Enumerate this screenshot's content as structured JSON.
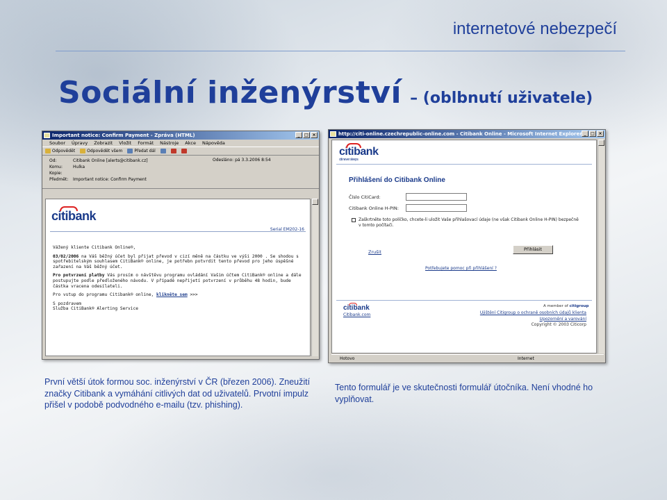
{
  "header": {
    "title": "internetové nebezpečí"
  },
  "slide": {
    "title": "Sociální inženýrství",
    "subtitle": "– (oblbnutí uživatele)"
  },
  "email_window": {
    "title": "Important notice: Confirm Payment - Zpráva (HTML)",
    "menu": [
      "Soubor",
      "Úpravy",
      "Zobrazit",
      "Vložit",
      "Formát",
      "Nástroje",
      "Akce",
      "Nápověda"
    ],
    "toolbar": [
      "Odpovědět",
      "Odpovědět všem",
      "Předat dál"
    ],
    "header_fields": {
      "from_label": "Od:",
      "from_value": "Citibank Online [alerts@citibank.cz]",
      "sent_label": "Odesláno:",
      "sent_value": "pá 3.3.2006 8:54",
      "to_label": "Komu:",
      "to_value": "Hulka",
      "cc_label": "Kopie:",
      "cc_value": "",
      "subject_label": "Předmět:",
      "subject_value": "Important notice: Confirm Payment"
    },
    "logo": "citibank",
    "serial": "Serial EM202-16",
    "body": {
      "greeting": "Vážený kliente Citibank Online®,",
      "p1_date": "03/02/2006",
      "p1": " na Váš běžný účet byl přijat převod v cizí měně na částku ve výši 2000 . Se shodou s spotřebitelským souhlasem CitiBank® online, je potřebn potvrdit tento převod pro jeho úspěšné zařazení na Váš běžný účet.",
      "p2_lead": "Pro potvrzení platby",
      "p2": " Vás prosím o návštěvu programu ovládání Vašim účtem CitiBank® online a dále postupujte podle předloženého návodu. V případě nepřijetí potvrzení v průběhu 48 hodin, bude částka vracena odesílateli.",
      "p3_text": "Pro vstup do programu Citibank® online, ",
      "p3_link": "klikněte sem",
      "p3_tail": " >>>",
      "sign1": "S pozdravem",
      "sign2": "Služba CitiBank® Alerting Service"
    }
  },
  "ie_window": {
    "title": "http://citi-online.czechrepublic-online.com - Citibank Online - Microsoft Internet Explorer",
    "logo": "citibank",
    "logo_tag": "citi never sleeps",
    "heading": "Přihlášení do Citibank Online",
    "card_label": "Číslo CitiCard:",
    "pin_label": "Citibank Online H-PIN:",
    "remember_text": "Zaškrtněte toto políčko, chcete-li uložit Vaše přihlašovací údaje (ne však Citibank Online H-PIN) bezpečně v tomto počítači.",
    "cancel_link": "Zrušit",
    "login_button": "Přihlásit",
    "help_link": "Potřebujete pomoc při přihlášení ?",
    "footer_logo": "citibank",
    "footer_link": "Citibank.com",
    "member_text": "A member of",
    "member_brand": "citigroup",
    "footer_links": [
      "Ujištění Citigroup o ochraně osobních údajů klienta",
      "Upozornění a varování"
    ],
    "copyright": "Copyright © 2003 Citicorp",
    "status_left": "Hotovo",
    "status_zone": "Internet"
  },
  "captions": {
    "left": "První větší útok formou soc. inženýrství v ČR (březen 2006). Zneužití značky Citibank a vymáhání citlivých dat od uživatelů. Prvotní impulz přišel v podobě podvodného e-mailu (tzv. phishing).",
    "right": "Tento formulář je ve skutečnosti formulář útočníka. Není vhodné ho vyplňovat."
  },
  "colors": {
    "accent": "#1f3f9a",
    "titlebar": "#0a246a",
    "citi_red": "#dd2222"
  }
}
